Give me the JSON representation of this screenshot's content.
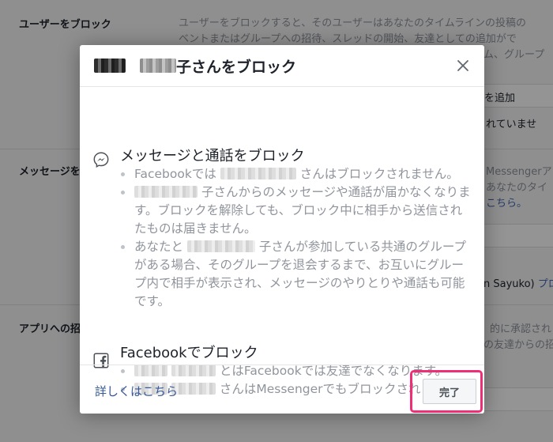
{
  "background": {
    "sections": [
      {
        "title": "ユーザーをブロック",
        "text_lines": [
          "ユーザーをブロックすると、そのユーザーはあなたのタイムラインの投稿の",
          "ベントまたはグループへの招待、スレッドの開始、友達としての追加がで",
          "ム、グループ"
        ]
      },
      {
        "title": "メッセージを",
        "text_lines": [
          "Messengerアプリ",
          "あなたのタイ",
          "こちら。"
        ]
      },
      {
        "title": "アプリへの招",
        "text_lines": [
          "的に承認され",
          "の友達からの招"
        ]
      }
    ],
    "add_text": "を追加",
    "not_text": "れていませ",
    "sayuko_text": "n Sayuko)",
    "sayuko_link": "プロ"
  },
  "dialog": {
    "title_suffix": "子さんをブロック",
    "close_label": "×",
    "sections": [
      {
        "icon": "messenger-icon",
        "title": "メッセージと通話をブロック",
        "bullets": [
          {
            "before": "Facebookでは",
            "after": "さんはブロックされません。"
          },
          {
            "before": "",
            "after": "子さんからのメッセージや通話が届かなくなります。ブロックを解除しても、ブロック中に相手から送信されたものは届きません。"
          },
          {
            "before": "あなたと",
            "after": "子さんが参加している共通のグループがある場合、そのグループを退会するまで、お互いにグループ内で相手が表示され、メッセージのやりとりや通話も可能です。"
          }
        ]
      },
      {
        "icon": "facebook-icon",
        "title": "Facebookでブロック",
        "bullets": [
          {
            "before": "",
            "after": "とはFacebookでは友達でなくなります。"
          },
          {
            "before": "",
            "after": "さんはMessengerでもブロックされます。"
          }
        ]
      }
    ],
    "footer": {
      "learn_more": "詳しくはこちら",
      "done": "完了"
    }
  },
  "colors": {
    "link": "#365899",
    "highlight": "#ef2e78",
    "muted_text": "#90949c"
  }
}
